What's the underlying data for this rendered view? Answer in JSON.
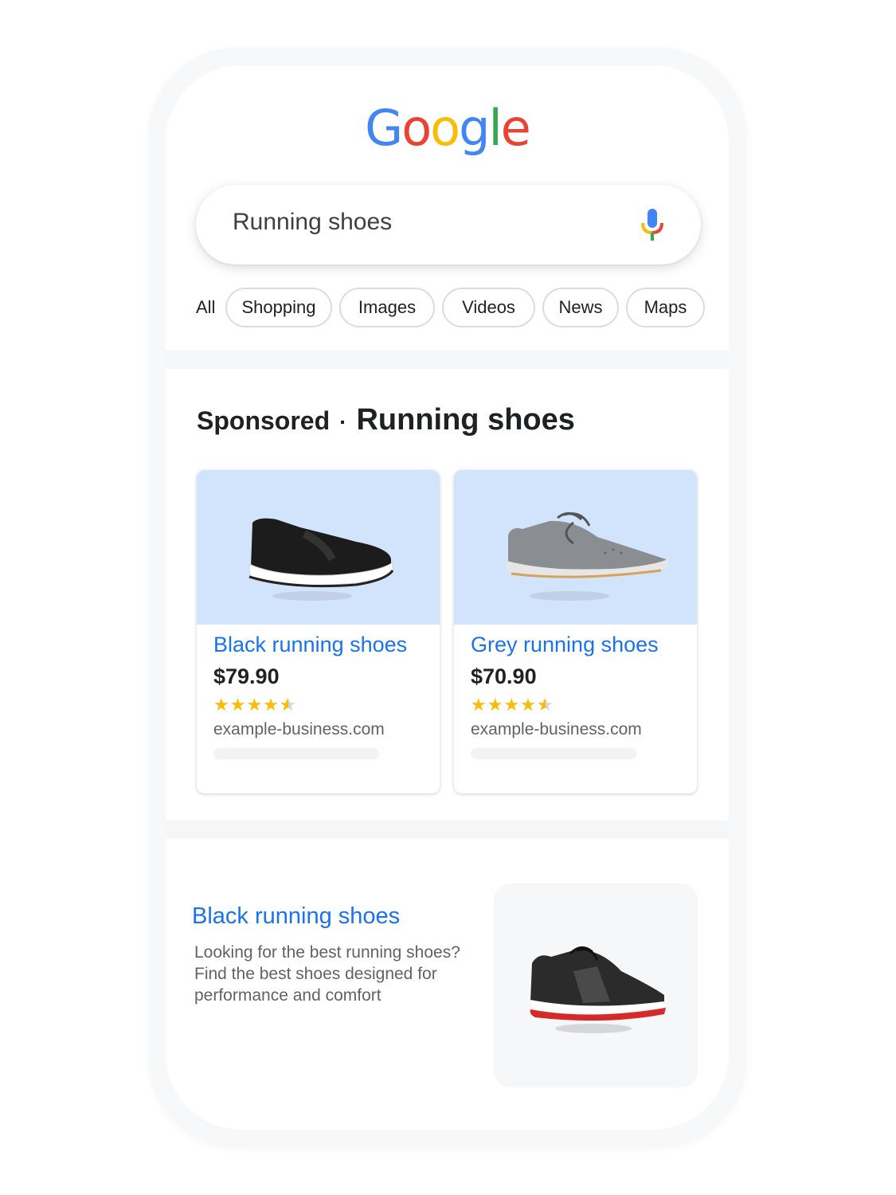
{
  "logo": {
    "letters": [
      "G",
      "o",
      "o",
      "g",
      "l",
      "e"
    ],
    "colors": [
      "#4285F4",
      "#EA4335",
      "#FBBC05",
      "#4285F4",
      "#34A853",
      "#EA4335"
    ]
  },
  "search": {
    "query": "Running shoes",
    "mic_icon": "microphone-icon"
  },
  "filters": {
    "all_label": "All",
    "chips": [
      "Shopping",
      "Images",
      "Videos",
      "News",
      "Maps"
    ]
  },
  "sponsored": {
    "label": "Sponsored",
    "separator": "·",
    "query_title": "Running shoes",
    "products": [
      {
        "title": "Black running shoes",
        "price": "$79.90",
        "rating": 4.5,
        "site": "example-business.com",
        "image_icon": "black-slip-on-shoe-image"
      },
      {
        "title": "Grey running shoes",
        "price": "$70.90",
        "rating": 4.5,
        "site": "example-business.com",
        "image_icon": "grey-lace-up-shoe-image"
      }
    ]
  },
  "organic": {
    "title": "Black running shoes",
    "description": "Looking for the best running shoes? Find the best shoes designed for performance and comfort",
    "image_icon": "black-red-running-shoe-image"
  },
  "colors": {
    "link_blue": "#1a73e8",
    "star_gold": "#fbbc04",
    "card_image_bg": "#d2e3fc"
  }
}
